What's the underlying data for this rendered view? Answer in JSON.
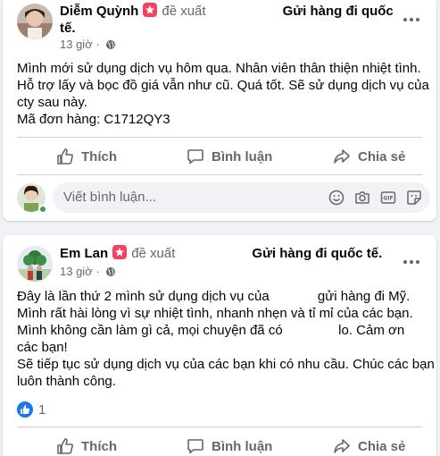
{
  "posts": [
    {
      "author": "Diễm Quỳnh",
      "suggest_label": "đề xuất",
      "group": "Gửi hàng đi quốc",
      "group_cont": "tế.",
      "time": "13 giờ ·",
      "lines": [
        "Mình mới sử dụng dịch vụ hôm qua. Nhân viên thân thiện nhiệt tình.",
        "Hỗ trợ lấy và bọc đồ giá vẫn như cũ. Quá tốt. Sẽ sử dụng dịch vụ của",
        "cty sau này.",
        "Mã đơn hàng: C1712QY3"
      ],
      "actions": {
        "like": "Thích",
        "comment": "Bình luận",
        "share": "Chia sẻ"
      },
      "comment_placeholder": "Viết bình luận..."
    },
    {
      "author": "Em Lan",
      "suggest_label": "đề xuất",
      "group": "Gửi hàng đi quốc tế.",
      "time": "13 giờ ·",
      "lines": [
        "Đây là lần thứ 2 mình sử dụng dịch vụ của             gửi hàng đi Mỹ.",
        "Mình rất hài lòng vì sự nhiệt tình, nhanh nhẹn và tỉ mỉ của các bạn.",
        "Mình không cần làm gì cả, mọi chuyện đã có               lo. Cảm ơn",
        "các bạn!",
        "Sẽ tiếp tục sử dụng dịch vụ của các bạn khi có nhu cầu. Chúc các bạn",
        "luôn thành công."
      ],
      "reaction_count": "1",
      "actions": {
        "like": "Thích",
        "comment": "Bình luận",
        "share": "Chia sẻ"
      }
    }
  ],
  "colors": {
    "badge": "#f3425f",
    "like_blue": "#1877f2",
    "muted": "#65676b",
    "online": "#31a24c"
  },
  "icons": [
    "star-badge-icon",
    "globe-icon",
    "more-dots-icon",
    "like-icon",
    "comment-icon",
    "share-icon",
    "emoji-icon",
    "camera-icon",
    "gif-icon",
    "sticker-icon"
  ]
}
